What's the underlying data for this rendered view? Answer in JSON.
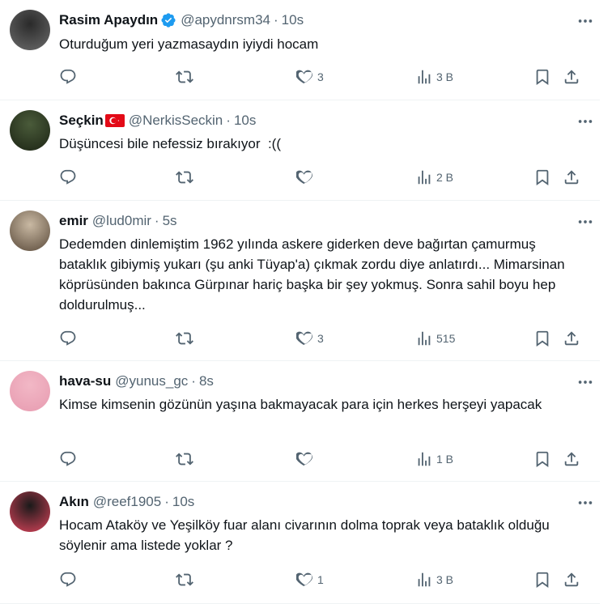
{
  "replies": [
    {
      "name": "Rasim Apaydın",
      "verified": true,
      "flag": false,
      "handle": "@apydnrsm34",
      "sep": "·",
      "time": "10s",
      "text": "Oturduğum yeri yazmasaydın iyiydi hocam",
      "replies": "",
      "retweets": "",
      "likes": "3",
      "views": "3 B",
      "avatar_colors": [
        "#2a2a2a",
        "#6b6b6b"
      ]
    },
    {
      "name": "Seçkin",
      "verified": false,
      "flag": true,
      "handle": "@NerkisSeckin",
      "sep": "·",
      "time": "10s",
      "text": "Düşüncesi bile nefessiz bırakıyor  :((",
      "replies": "",
      "retweets": "",
      "likes": "",
      "views": "2 B",
      "avatar_colors": [
        "#4a5b3a",
        "#1c2414"
      ]
    },
    {
      "name": "emir",
      "verified": false,
      "flag": false,
      "handle": "@lud0mir",
      "sep": "·",
      "time": "5s",
      "text": "Dedemden dinlemiştim 1962 yılında askere giderken deve bağırtan çamurmuş bataklık gibiymiş yukarı (şu anki Tüyap'a) çıkmak zordu diye anlatırdı... Mimarsinan köprüsünden bakınca Gürpınar hariç başka bir şey yokmuş. Sonra sahil boyu hep doldurulmuş...",
      "replies": "",
      "retweets": "",
      "likes": "3",
      "views": "515",
      "avatar_colors": [
        "#c9b9a3",
        "#5a4a3a"
      ]
    },
    {
      "name": "hava-su",
      "verified": false,
      "flag": false,
      "handle": "@yunus_gc",
      "sep": "·",
      "time": "8s",
      "text": "Kimse kimsenin gözünün yaşına bakmayacak para için herkes herşeyi yapacak",
      "replies": "",
      "retweets": "",
      "likes": "",
      "views": "1 B",
      "avatar_colors": [
        "#f2b8c6",
        "#e79bb0"
      ]
    },
    {
      "name": "Akın",
      "verified": false,
      "flag": false,
      "handle": "@reef1905",
      "sep": "·",
      "time": "10s",
      "text": "Hocam Ataköy ve Yeşilköy fuar alanı civarının dolma toprak veya bataklık olduğu söylenir ama listede yoklar ?",
      "replies": "",
      "retweets": "",
      "likes": "1",
      "views": "3 B",
      "avatar_colors": [
        "#1a1a1a",
        "#d9435a"
      ]
    }
  ],
  "icons": {
    "verified": "verified-badge-icon",
    "flag": "turkey-flag-icon",
    "more": "more-icon",
    "reply": "reply-icon",
    "retweet": "retweet-icon",
    "like": "like-icon",
    "views": "views-icon",
    "bookmark": "bookmark-icon",
    "share": "share-icon"
  },
  "colors": {
    "text": "#0f1419",
    "secondary": "#536471",
    "verified": "#1d9bf0",
    "divider": "#eff3f4",
    "flag_red": "#e30a17"
  }
}
